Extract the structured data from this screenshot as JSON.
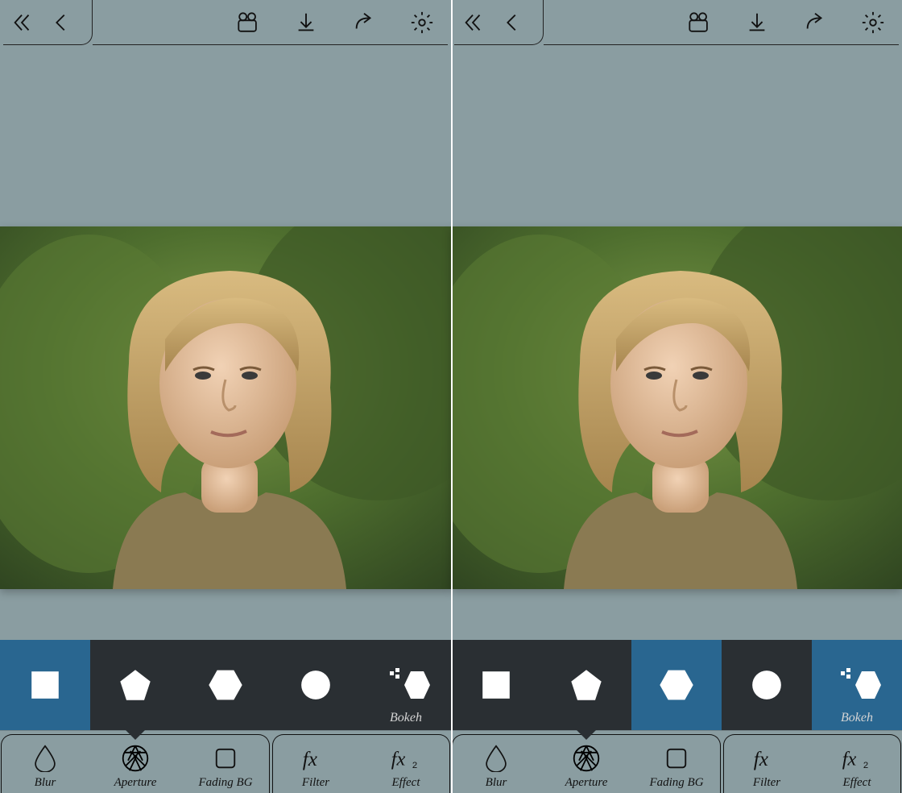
{
  "panels": [
    {
      "shapes": [
        {
          "type": "square",
          "selected": true
        },
        {
          "type": "pentagon",
          "selected": false
        },
        {
          "type": "hexagon",
          "selected": false
        },
        {
          "type": "circle",
          "selected": false
        },
        {
          "type": "extra",
          "selected": false,
          "label": "Bokeh"
        }
      ]
    },
    {
      "shapes": [
        {
          "type": "square",
          "selected": false
        },
        {
          "type": "pentagon",
          "selected": false
        },
        {
          "type": "hexagon",
          "selected": true
        },
        {
          "type": "circle",
          "selected": false
        },
        {
          "type": "extra",
          "selected": true,
          "label": "Bokeh"
        }
      ]
    }
  ],
  "shape_strip": {
    "bokeh_label": "Bokeh"
  },
  "tools": [
    {
      "key": "blur",
      "label": "Blur",
      "icon": "drop-icon"
    },
    {
      "key": "aperture",
      "label": "Aperture",
      "icon": "aperture-icon",
      "active": true
    },
    {
      "key": "fadingbg",
      "label": "Fading BG",
      "icon": "square-icon"
    },
    {
      "key": "filter",
      "label": "Filter",
      "icon": "fx-icon"
    },
    {
      "key": "effect",
      "label": "Effect",
      "icon": "fx2-icon"
    }
  ],
  "topbar": {
    "icons": [
      "double-back-icon",
      "back-icon",
      "video-icon",
      "download-icon",
      "share-icon",
      "settings-icon"
    ]
  }
}
